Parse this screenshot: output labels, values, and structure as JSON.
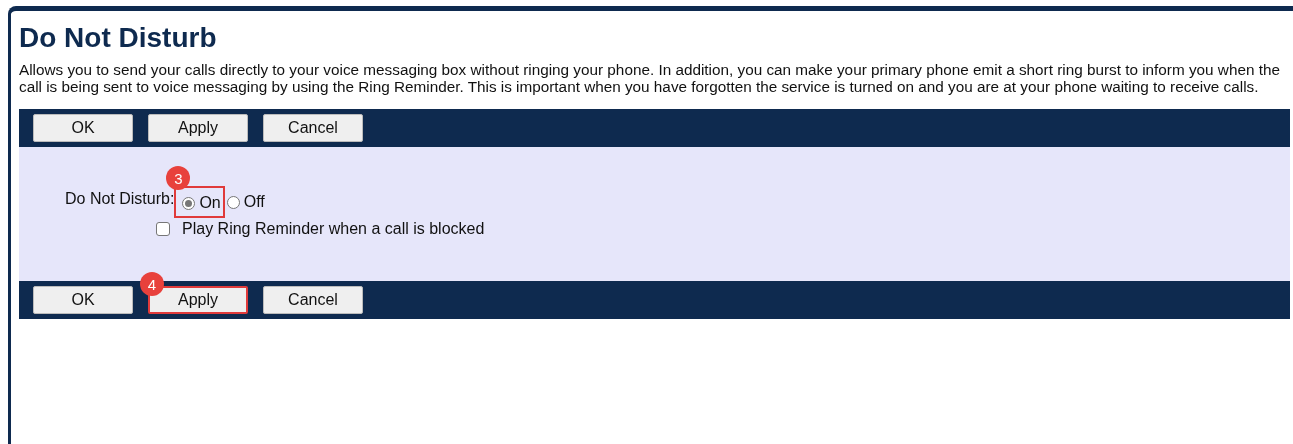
{
  "title": "Do Not Disturb",
  "description": "Allows you to send your calls directly to your voice messaging box without ringing your phone. In addition, you can make your primary phone emit a short ring burst to inform you when the call is being sent to voice messaging by using the Ring Reminder. This is important when you have forgotten the service is turned on and you are at your phone waiting to receive calls.",
  "top_toolbar": [
    {
      "label": "OK"
    },
    {
      "label": "Apply"
    },
    {
      "label": "Cancel"
    }
  ],
  "dnd": {
    "label": "Do Not Disturb:",
    "options": [
      {
        "label": "On",
        "selected": true,
        "callout": "3"
      },
      {
        "label": "Off",
        "selected": false
      }
    ]
  },
  "ring_reminder": {
    "label": "Play Ring Reminder when a call is blocked",
    "checked": false
  },
  "bottom_toolbar": [
    {
      "label": "OK"
    },
    {
      "label": "Apply",
      "callout": "4"
    },
    {
      "label": "Cancel"
    }
  ]
}
